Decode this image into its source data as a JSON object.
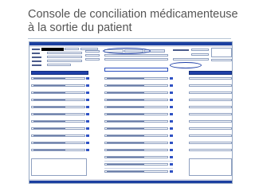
{
  "slide": {
    "title": "Console de conciliation médicamenteuse\nà la sortie du patient"
  },
  "screenshot": {
    "app_name": "Console de conciliation",
    "columns": [
      "left-column",
      "middle-column",
      "right-column"
    ],
    "row_count": 14,
    "colors": {
      "brand": "#1f3fa8",
      "title_bar": "#1b3fa0",
      "field_border": "#8fa0c0",
      "menu_bg": "#d7dbe8"
    }
  }
}
